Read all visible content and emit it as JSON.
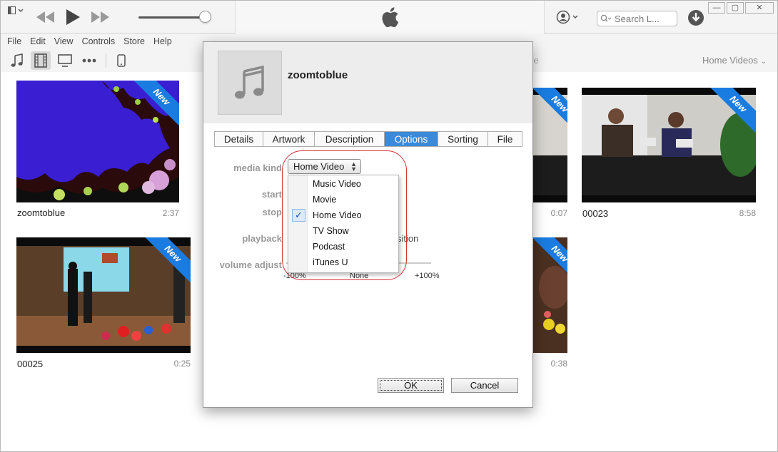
{
  "toolbar": {
    "search_placeholder": "Search L...",
    "window_buttons": [
      "—",
      "▢",
      "✕"
    ]
  },
  "menubar": [
    "File",
    "Edit",
    "View",
    "Controls",
    "Store",
    "Help"
  ],
  "library": {
    "view_label": "Home Videos",
    "obscured_tab_fragment": "re",
    "new_badge": "New",
    "tiles": [
      {
        "title": "zoomtoblue",
        "duration": "2:37"
      },
      {
        "title": "00023",
        "duration": "8:58"
      },
      {
        "title": "00025",
        "duration": "0:25"
      },
      {
        "title": "",
        "duration": "0:07"
      },
      {
        "title": "",
        "duration": "0:38"
      }
    ]
  },
  "dialog": {
    "title": "zoomtoblue",
    "tabs": [
      "Details",
      "Artwork",
      "Description",
      "Options",
      "Sorting",
      "File"
    ],
    "active_tab": "Options",
    "labels": {
      "media_kind": "media kind",
      "start": "start",
      "stop": "stop",
      "playback": "playback",
      "volume_adjust": "volume adjust"
    },
    "media_kind_value": "Home Video",
    "playback_fragment": "sition",
    "slider_ticks": {
      "min": "-100%",
      "mid": "None",
      "max": "+100%"
    },
    "dropdown_options": [
      "Music Video",
      "Movie",
      "Home Video",
      "TV Show",
      "Podcast",
      "iTunes U"
    ],
    "selected_option": "Home Video",
    "ok_label": "OK",
    "cancel_label": "Cancel"
  },
  "colors": {
    "accent": "#3a8ad9",
    "ribbon": "#1a7be0",
    "highlight": "#d4333b"
  }
}
